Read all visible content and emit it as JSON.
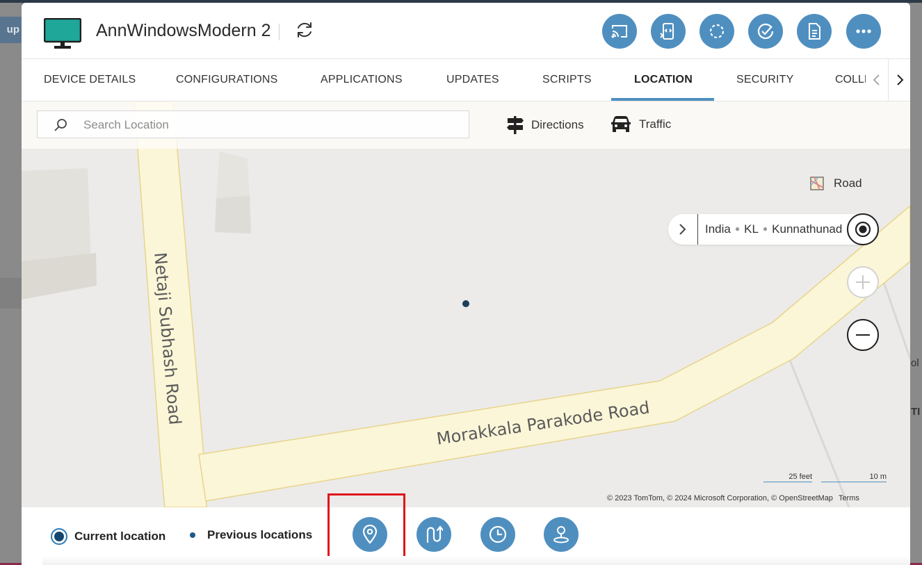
{
  "background": {
    "left_fragment": "up"
  },
  "header": {
    "device_name": "AnnWindowsModern 2",
    "icons": [
      "monitor-icon",
      "refresh-icon",
      "cast-icon",
      "remote-script-icon",
      "sync-icon",
      "check-circle-icon",
      "document-icon",
      "more-icon"
    ]
  },
  "tabs": {
    "items": [
      "DEVICE DETAILS",
      "CONFIGURATIONS",
      "APPLICATIONS",
      "UPDATES",
      "SCRIPTS",
      "LOCATION",
      "SECURITY"
    ],
    "overflow_fragment": "COLLI",
    "active": "LOCATION"
  },
  "map": {
    "search_placeholder": "Search Location",
    "directions_label": "Directions",
    "traffic_label": "Traffic",
    "style_label": "Road",
    "breadcrumb": [
      "India",
      "KL",
      "Kunnathunad"
    ],
    "roads": [
      "Netaji Subhash Road",
      "Morakkala Parakode Road"
    ],
    "scale": {
      "imperial": "25 feet",
      "metric": "10 m"
    },
    "attribution": "© 2023 TomTom, © 2024 Microsoft Corporation, © OpenStreetMap",
    "terms": "Terms"
  },
  "legend": {
    "current_label": "Current location",
    "previous_label": "Previous locations",
    "buttons": [
      "location-pin-icon",
      "route-icon",
      "history-clock-icon",
      "person-location-icon"
    ]
  },
  "colors": {
    "accent": "#4f8fc0",
    "road_fill": "#fbf6d8",
    "road_edge": "#e8d48a",
    "highlight": "#e0141b"
  }
}
